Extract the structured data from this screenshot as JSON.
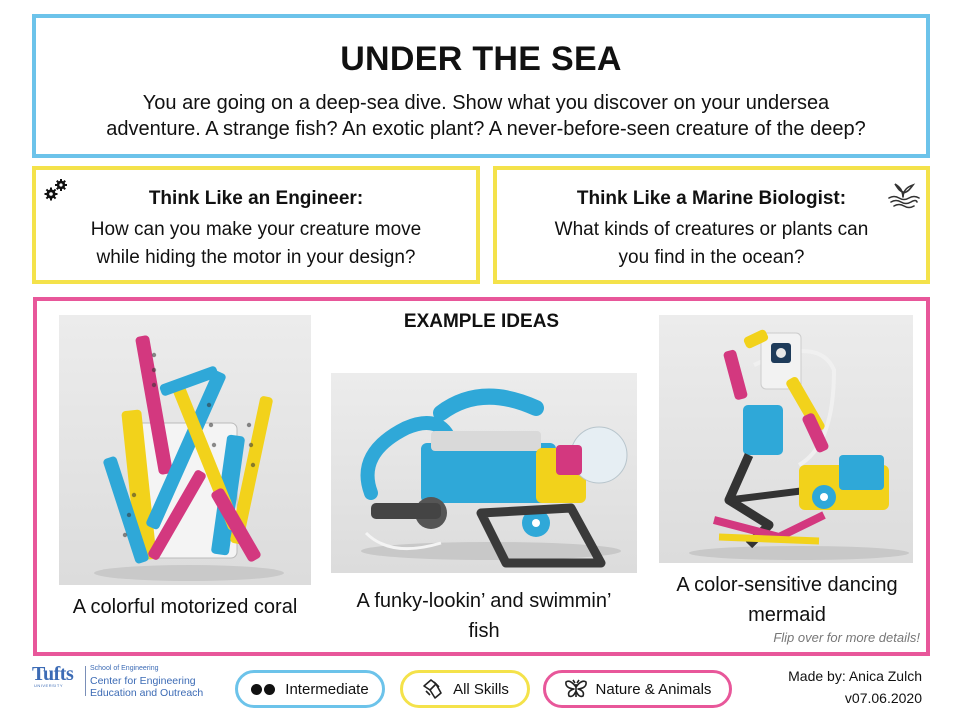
{
  "header": {
    "title": "UNDER THE SEA",
    "intro_line1": "You are going on a deep-sea dive. Show what you discover on your undersea",
    "intro_line2": "adventure. A strange fish? An exotic plant? A never-before-seen creature of the deep?"
  },
  "engineer": {
    "icon": "gears-icon",
    "heading": "Think Like an Engineer:",
    "line1": "How can you make your creature move",
    "line2": "while hiding the motor in your design?"
  },
  "biologist": {
    "icon": "whale-tail-icon",
    "heading": "Think Like a Marine Biologist:",
    "line1": "What kinds of creatures or plants can",
    "line2": "you find in the ocean?"
  },
  "examples": {
    "title": "EXAMPLE IDEAS",
    "items": [
      {
        "photo": "coral-photo",
        "caption_line1": "A colorful motorized coral",
        "caption_line2": ""
      },
      {
        "photo": "fish-photo",
        "caption_line1": "A funky-lookin’ and swimmin’",
        "caption_line2": "fish"
      },
      {
        "photo": "mermaid-photo",
        "caption_line1": "A color-sensitive dancing",
        "caption_line2": "mermaid"
      }
    ],
    "flip_note": "Flip over for more details!"
  },
  "logo": {
    "wordmark": "Tufts",
    "sub": "UNIVERSITY",
    "school": "School of Engineering",
    "line1": "Center for Engineering",
    "line2": "Education and Outreach"
  },
  "tags": {
    "level": "Intermediate",
    "skills": "All Skills",
    "theme": "Nature & Animals"
  },
  "credit": {
    "author": "Made by: Anica Zulch",
    "version": "v07.06.2020"
  },
  "colors": {
    "blue": "#6cc3ea",
    "yellow": "#f4e24a",
    "pink": "#e8579a",
    "lego_cyan": "#2fa8d8",
    "lego_yellow": "#f2d21b",
    "lego_magenta": "#d3387f"
  }
}
